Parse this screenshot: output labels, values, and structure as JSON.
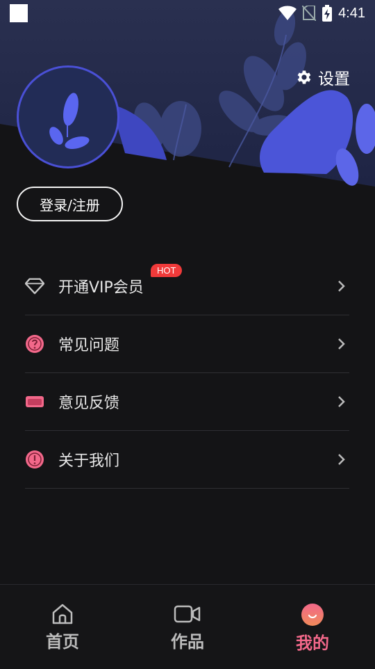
{
  "status_bar": {
    "time": "4:41",
    "icons": [
      "notification-square-icon",
      "wifi-icon",
      "no-sim-icon",
      "battery-charging-icon"
    ]
  },
  "header": {
    "settings_label": "设置",
    "avatar_icon": "leaf-sprout-icon"
  },
  "auth": {
    "login_label": "登录/注册"
  },
  "menu": {
    "items": [
      {
        "label": "开通VIP会员",
        "icon": "diamond-icon",
        "badge": "HOT"
      },
      {
        "label": "常见问题",
        "icon": "question-circle-icon"
      },
      {
        "label": "意见反馈",
        "icon": "card-icon"
      },
      {
        "label": "关于我们",
        "icon": "info-exclamation-icon"
      }
    ]
  },
  "tab_bar": {
    "tabs": [
      {
        "label": "首页",
        "icon": "home-icon",
        "active": false
      },
      {
        "label": "作品",
        "icon": "video-camera-icon",
        "active": false
      },
      {
        "label": "我的",
        "icon": "smile-face-icon",
        "active": true
      }
    ]
  },
  "colors": {
    "background": "#141416",
    "header_gradient_top": "#242a4e",
    "accent_blue": "#4a50d6",
    "accent_pink": "#f2688a",
    "hot_badge": "#f03a3a"
  }
}
